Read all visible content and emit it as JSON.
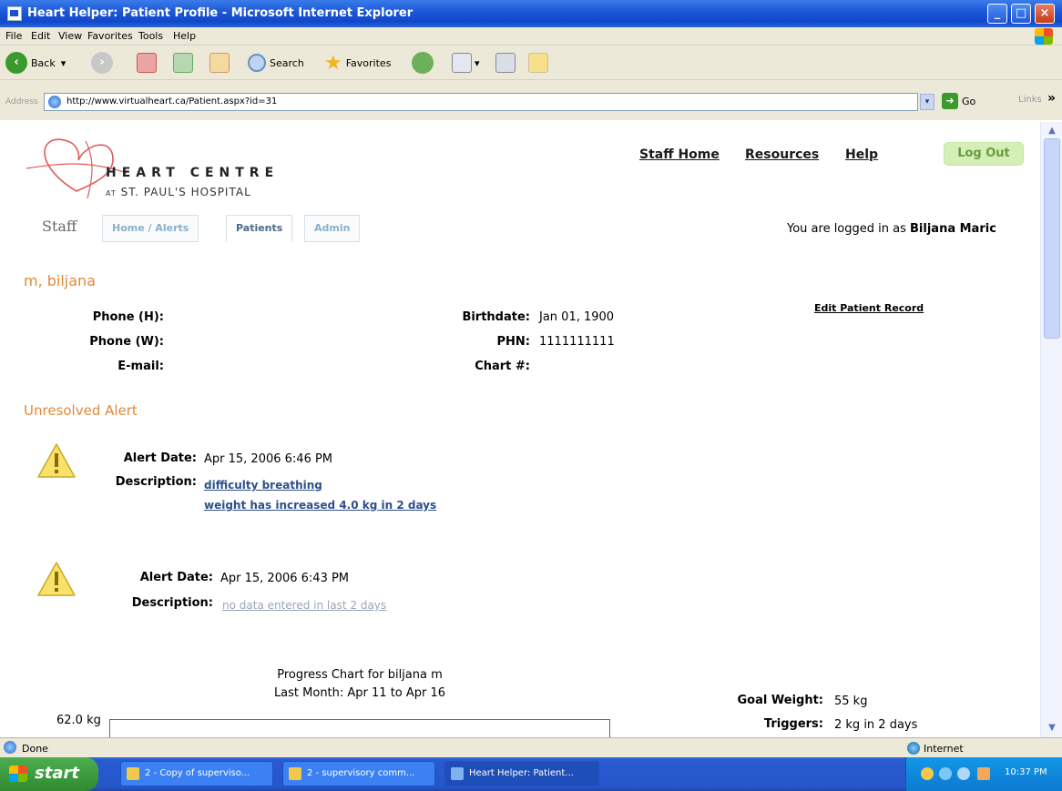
{
  "window": {
    "title": "Heart Helper: Patient Profile - Microsoft Internet Explorer",
    "minimize_glyph": "_",
    "maximize_glyph": "□",
    "close_glyph": "×"
  },
  "menubar": {
    "items": [
      "File",
      "Edit",
      "View",
      "Favorites",
      "Tools",
      "Help"
    ]
  },
  "toolbar": {
    "back_label": "Back",
    "back_dropdown": "▾",
    "search_label": "Search",
    "favorites_label": "Favorites"
  },
  "addressbar": {
    "label": "Address",
    "url": "http://www.virtualheart.ca/Patient.aspx?id=31",
    "go_label": "Go",
    "links_label": "Links",
    "chevron": "»"
  },
  "site": {
    "logo_title": "HEART CENTRE",
    "logo_at": "AT",
    "logo_subtitle": "ST. PAUL'S HOSPITAL",
    "nav": {
      "staff_home": "Staff Home",
      "resources": "Resources",
      "help": "Help",
      "logout": "Log Out"
    },
    "section_label": "Staff",
    "tabs": [
      "Home / Alerts",
      "Patients",
      "Admin"
    ],
    "active_tab": "Patients",
    "logged_in_prefix": "You are logged in as",
    "logged_in_user": "Biljana Maric"
  },
  "patient": {
    "name": "m, biljana",
    "edit_link": "Edit Patient Record",
    "phone_h_label": "Phone (H):",
    "phone_h": "",
    "phone_w_label": "Phone (W):",
    "phone_w": "",
    "email_label": "E-mail:",
    "email": "",
    "birthdate_label": "Birthdate:",
    "birthdate": "Jan 01, 1900",
    "phn_label": "PHN:",
    "phn": "1111111111",
    "chart_label": "Chart #:",
    "chart_no": ""
  },
  "alerts": {
    "section_title": "Unresolved Alert",
    "date_label": "Alert Date:",
    "description_label": "Description:",
    "items": [
      {
        "date": "Apr 15, 2006 6:46 PM",
        "descriptions": [
          "difficulty breathing",
          "weight has increased 4.0 kg in 2 days"
        ]
      },
      {
        "date": "Apr 15, 2006 6:43 PM",
        "descriptions": [
          "no data entered in last 2 days"
        ]
      }
    ]
  },
  "progress": {
    "title_line1": "Progress Chart for biljana m",
    "title_line2": "Last Month: Apr 11 to Apr 16",
    "y_top_label": "62.0 kg",
    "goal_weight_label": "Goal Weight:",
    "goal_weight": "55 kg",
    "triggers_label": "Triggers:",
    "triggers": "2 kg in 2 days"
  },
  "statusbar": {
    "status": "Done",
    "zone": "Internet"
  },
  "taskbar": {
    "start_label": "start",
    "tasks": [
      "2 - Copy of superviso...",
      "2 - supervisory comm...",
      "Heart Helper: Patient..."
    ],
    "clock": "10:37 PM"
  },
  "colors": {
    "accent_orange": "#e08a3a",
    "link_blue": "#2e4f8a",
    "logout_green": "#6a9b3d",
    "xp_title_blue": "#1b56d6"
  }
}
